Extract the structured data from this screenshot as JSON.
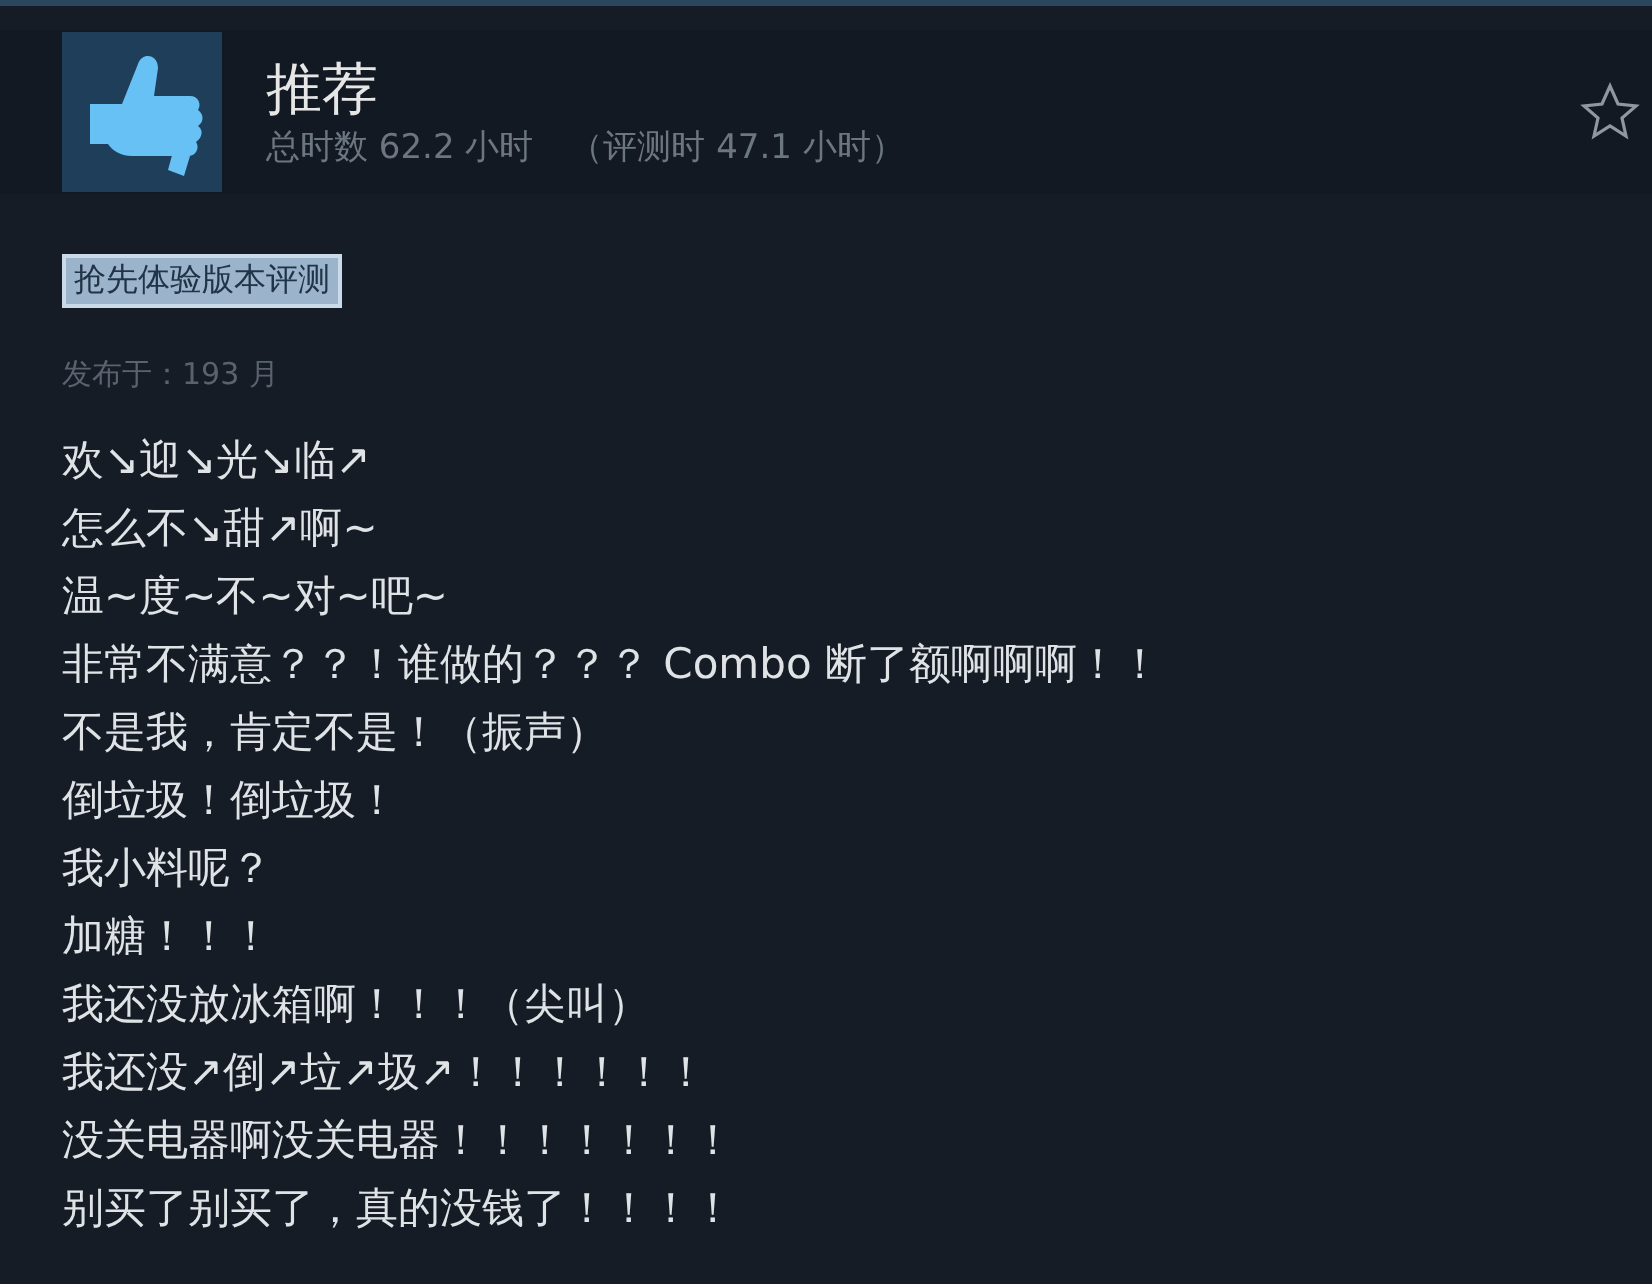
{
  "review": {
    "verdict": "推荐",
    "hours": "总时数 62.2 小时",
    "hours_at_review": "（评测时 47.1 小时）",
    "tag": "抢先体验版本评测",
    "posted": "发布于：193 月",
    "lines": [
      "欢↘迎↘光↘临↗",
      "怎么不↘甜↗啊~",
      "温~度~不~对~吧~",
      "非常不满意？？！谁做的？？？ Combo 断了额啊啊啊！！",
      "不是我，肯定不是！（振声）",
      "倒垃圾！倒垃圾！",
      "我小料呢？",
      "加糖！！！",
      "我还没放冰箱啊！！！（尖叫）",
      "我还没↗倒↗垃↗圾↗！！！！！！",
      "没关电器啊没关电器！！！！！！！",
      "别买了别买了，真的没钱了！！！！"
    ]
  }
}
